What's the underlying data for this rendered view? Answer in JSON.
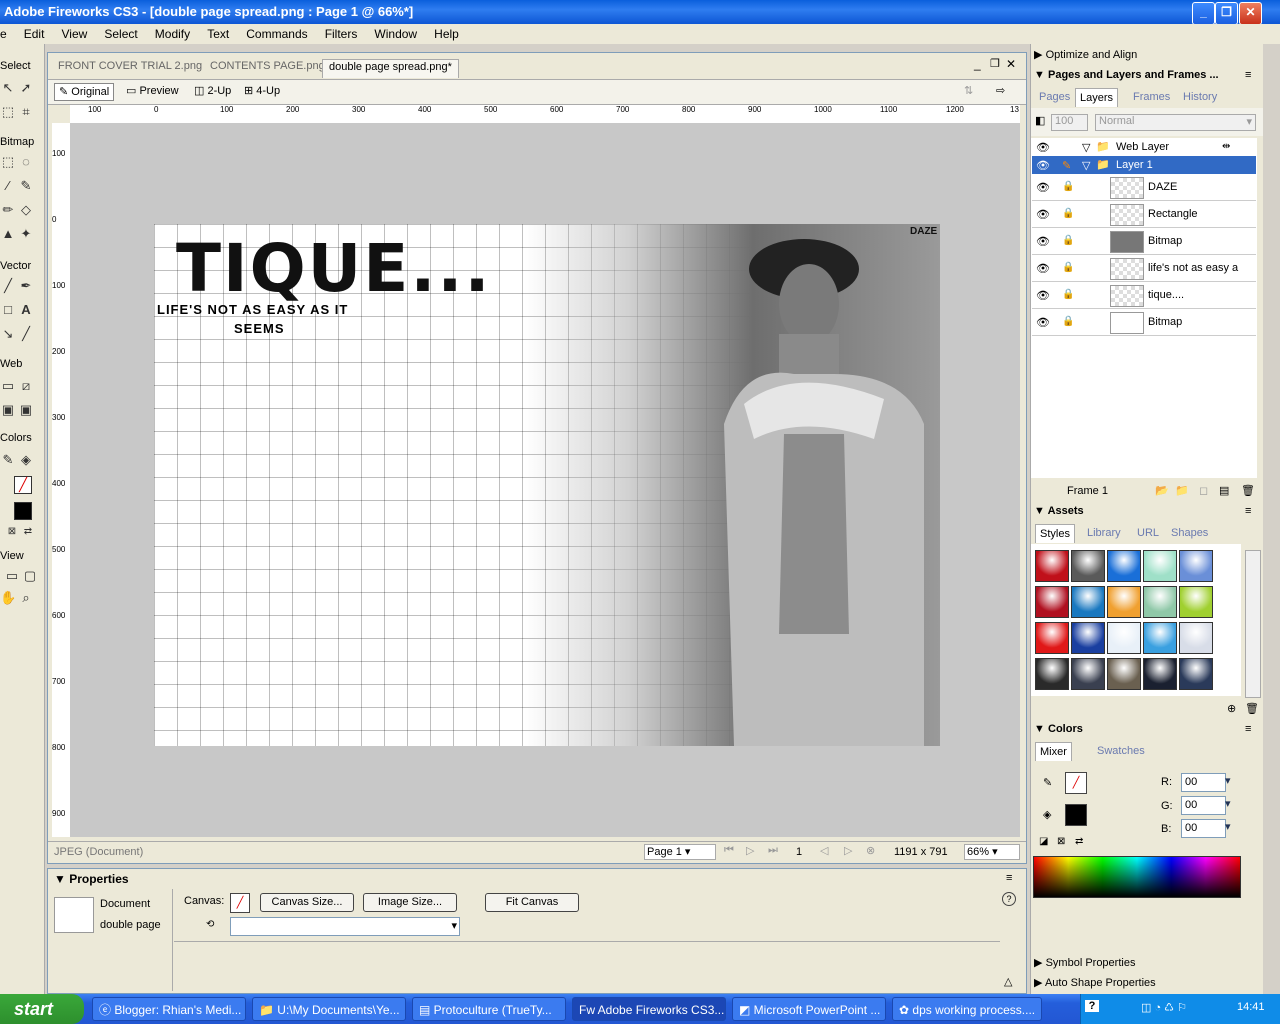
{
  "window": {
    "title": "Adobe Fireworks CS3 - [double page spread.png : Page 1 @  66%*]"
  },
  "menu": [
    "e",
    "Edit",
    "View",
    "Select",
    "Modify",
    "Text",
    "Commands",
    "Filters",
    "Window",
    "Help"
  ],
  "tools": {
    "select": "Select",
    "bitmap": "Bitmap",
    "vector": "Vector",
    "web": "Web",
    "colors": "Colors",
    "view": "View"
  },
  "document": {
    "tabs": [
      "FRONT COVER TRIAL 2.png",
      "CONTENTS PAGE.png",
      "double page spread.png*"
    ],
    "views": [
      "Original",
      "Preview",
      "2-Up",
      "4-Up"
    ],
    "hruler": [
      "100",
      "0",
      "100",
      "200",
      "300",
      "400",
      "500",
      "600",
      "700",
      "800",
      "900",
      "1000",
      "1100",
      "1200",
      "13"
    ],
    "vruler": [
      "100",
      "0",
      "100",
      "200",
      "300",
      "400",
      "500",
      "600",
      "700",
      "800",
      "900"
    ],
    "art": {
      "headline": "TIQUE...",
      "tagline1": "LIFE'S NOT AS EASY AS IT",
      "tagline2": "SEEMS",
      "logo": "DAZE"
    },
    "status": {
      "format": "JPEG (Document)",
      "page": "Page 1",
      "frame": "1",
      "size": "1191 x 791",
      "zoom": "66%"
    }
  },
  "properties": {
    "title": "Properties",
    "doc_label": "Document",
    "doc_name": "double page",
    "canvas_label": "Canvas:",
    "buttons": [
      "Canvas Size...",
      "Image Size...",
      "Fit Canvas"
    ],
    "help": "?"
  },
  "panels": {
    "optimize": "Optimize and Align",
    "pages_layers": "Pages and Layers and Frames ...",
    "pl_tabs": [
      "Pages",
      "Layers",
      "Frames",
      "History"
    ],
    "opacity": "100",
    "blend": "Normal",
    "layers": [
      {
        "name": "Web Layer"
      },
      {
        "name": "Layer 1"
      },
      {
        "name": "DAZE"
      },
      {
        "name": "Rectangle"
      },
      {
        "name": "Bitmap"
      },
      {
        "name": "life's not as easy a"
      },
      {
        "name": "tique...."
      },
      {
        "name": "Bitmap"
      }
    ],
    "frame_label": "Frame 1",
    "assets": "Assets",
    "asset_tabs": [
      "Styles",
      "Library",
      "URL",
      "Shapes"
    ],
    "styles": [
      "#c0101a",
      "#5a5a5a",
      "#1a6fd8",
      "#9fe0c8",
      "#6a8fd8",
      "#b01020",
      "#1a78c0",
      "#f0a030",
      "#8fc8a8",
      "#a0d030",
      "#e01818",
      "#1a3fa0",
      "#e8f0f8",
      "#3aa0e0",
      "#d8dde8",
      "#2a2a2a",
      "#3a4050",
      "#6a6050",
      "#1a2030",
      "#2a3a5a"
    ],
    "colors": "Colors",
    "color_tabs": [
      "Mixer",
      "Swatches"
    ],
    "rgb": [
      {
        "label": "R:",
        "value": "00"
      },
      {
        "label": "G:",
        "value": "00"
      },
      {
        "label": "B:",
        "value": "00"
      }
    ],
    "symbol": "Symbol Properties",
    "autoshape": "Auto Shape Properties"
  },
  "taskbar": {
    "start": "start",
    "items": [
      "Blogger: Rhian's Medi...",
      "U:\\My Documents\\Ye...",
      "Protoculture (TrueTy...",
      "Adobe Fireworks CS3...",
      "Microsoft PowerPoint ...",
      "dps working process...."
    ],
    "time": "14:41"
  }
}
